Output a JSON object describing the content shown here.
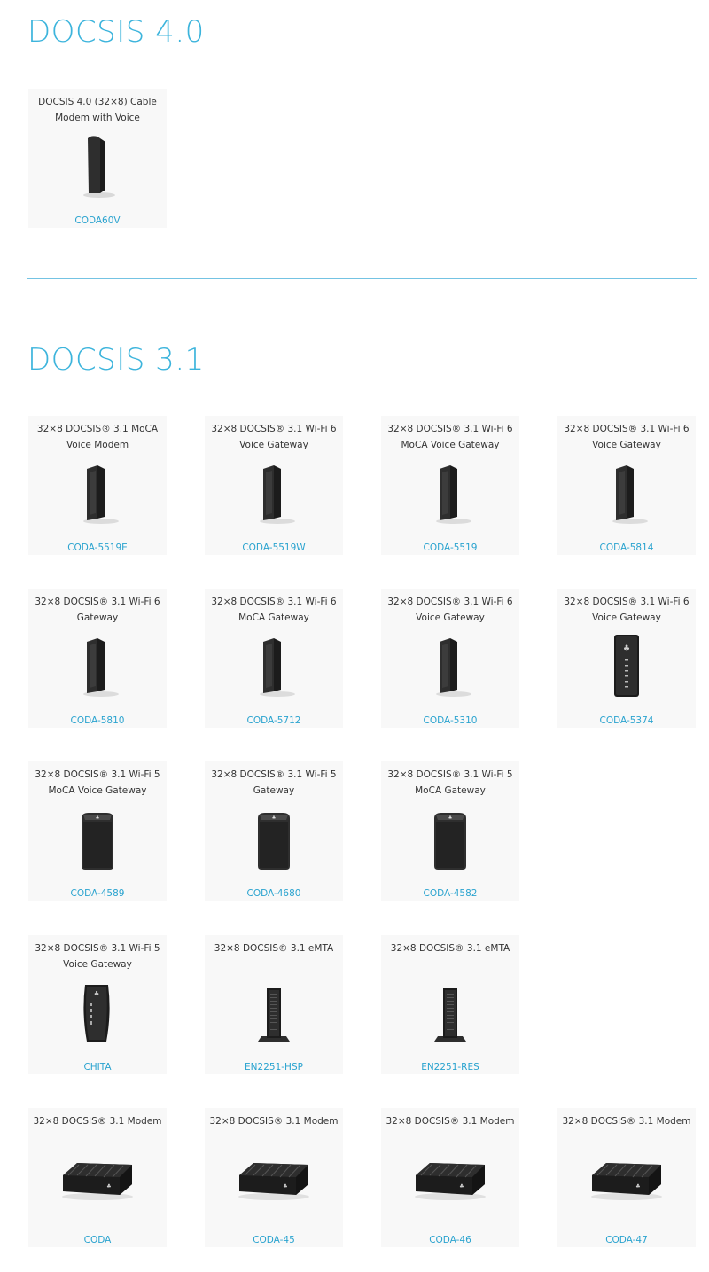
{
  "sections": [
    {
      "title": "DOCSIS 4.0",
      "products": [
        {
          "title": "DOCSIS 4.0 (32×8) Cable Modem with Voice",
          "link": "CODA60V",
          "icon": "slim-tower-device-icon"
        }
      ]
    },
    {
      "title": "DOCSIS 3.1",
      "products": [
        {
          "title": "32×8 DOCSIS® 3.1 MoCA Voice Modem",
          "link": "CODA-5519E",
          "icon": "tower-device-icon"
        },
        {
          "title": "32×8 DOCSIS® 3.1 Wi-Fi 6 Voice Gateway",
          "link": "CODA-5519W",
          "icon": "tower-device-icon"
        },
        {
          "title": "32×8 DOCSIS® 3.1 Wi-Fi 6 MoCA Voice Gateway",
          "link": "CODA-5519",
          "icon": "tower-device-icon"
        },
        {
          "title": "32×8 DOCSIS® 3.1 Wi-Fi 6 Voice Gateway",
          "link": "CODA-5814",
          "icon": "tower-device-icon"
        },
        {
          "title": "32×8 DOCSIS® 3.1 Wi-Fi 6 Gateway",
          "link": "CODA-5810",
          "icon": "tower-device-icon"
        },
        {
          "title": "32×8 DOCSIS® 3.1 Wi-Fi 6 MoCA Gateway",
          "link": "CODA-5712",
          "icon": "tower-device-icon"
        },
        {
          "title": "32×8 DOCSIS® 3.1 Wi-Fi 6 Voice Gateway",
          "link": "CODA-5310",
          "icon": "tower-device-icon"
        },
        {
          "title": "32×8 DOCSIS® 3.1 Wi-Fi 6 Voice Gateway",
          "link": "CODA-5374",
          "icon": "led-tower-device-icon"
        },
        {
          "title": "32×8 DOCSIS® 3.1 Wi-Fi 5 MoCA Voice Gateway",
          "link": "CODA-4589",
          "icon": "cube-device-icon"
        },
        {
          "title": "32×8 DOCSIS® 3.1 Wi-Fi 5 Gateway",
          "link": "CODA-4680",
          "icon": "cube-device-icon"
        },
        {
          "title": "32×8 DOCSIS® 3.1 Wi-Fi 5 MoCA Gateway",
          "link": "CODA-4582",
          "icon": "cube-device-icon"
        },
        {
          "title": "32×8 DOCSIS® 3.1 Wi-Fi 5 Voice Gateway",
          "link": "CHITA",
          "icon": "curved-device-icon"
        },
        {
          "title": "32×8 DOCSIS® 3.1 eMTA",
          "link": "EN2251-HSP",
          "icon": "emta-device-icon"
        },
        {
          "title": "32×8 DOCSIS® 3.1 eMTA",
          "link": "EN2251-RES",
          "icon": "emta-device-icon"
        },
        {
          "title": "32×8 DOCSIS® 3.1 Modem",
          "link": "CODA",
          "icon": "flat-modem-icon"
        },
        {
          "title": "32×8 DOCSIS® 3.1 Modem",
          "link": "CODA-45",
          "icon": "flat-modem-icon"
        },
        {
          "title": "32×8 DOCSIS® 3.1 Modem",
          "link": "CODA-46",
          "icon": "flat-modem-icon"
        },
        {
          "title": "32×8 DOCSIS® 3.1 Modem",
          "link": "CODA-47",
          "icon": "flat-modem-icon"
        }
      ]
    }
  ]
}
